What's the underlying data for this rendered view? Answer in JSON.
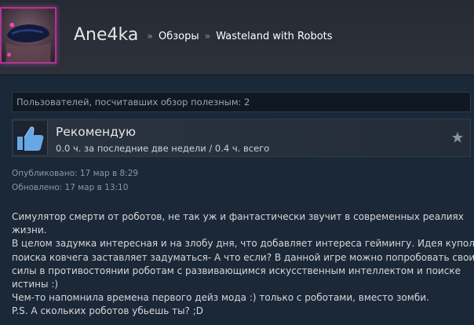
{
  "header": {
    "persona_name": "Ane4ka",
    "breadcrumb": [
      "Обзоры",
      "Wasteland with Robots"
    ],
    "separator": "»"
  },
  "helpful": {
    "text": "Пользователей, посчитавших обзор полезным: 2"
  },
  "rating": {
    "title": "Рекомендую",
    "hours": "0.0 ч. за последние две недели / 0.4 ч. всего",
    "icon": "thumbs-up-icon"
  },
  "dates": {
    "posted": "Опубликовано: 17 мар в 8:29",
    "updated": "Обновлено: 17 мар в 13:10"
  },
  "review": {
    "lines": [
      "Симулятор смерти от роботов, не так уж и фантастически звучит в современных реалиях",
      "жизни.",
      "В целом задумка интересная и на злобу дня, что добавляет интереса геймингу. Идея купола и",
      "поиска ковчега заставляет задуматься- А что если? В данной игре можно попробовать свои",
      "силы в противостоянии роботам с развивающимся искусственным интеллектом и поиске",
      "истины :)",
      "Чем-то напомнила времена первого дейз мода :) только с роботами, вместо зомби.",
      "P.S. А скольких роботов убьешь ты? ;D"
    ]
  },
  "colors": {
    "background": "#1b2838",
    "header": "#2a2f38",
    "avatar_border": "#b0368f",
    "thumb_blue": "#66a8e4",
    "muted_text": "#8f98a0"
  }
}
